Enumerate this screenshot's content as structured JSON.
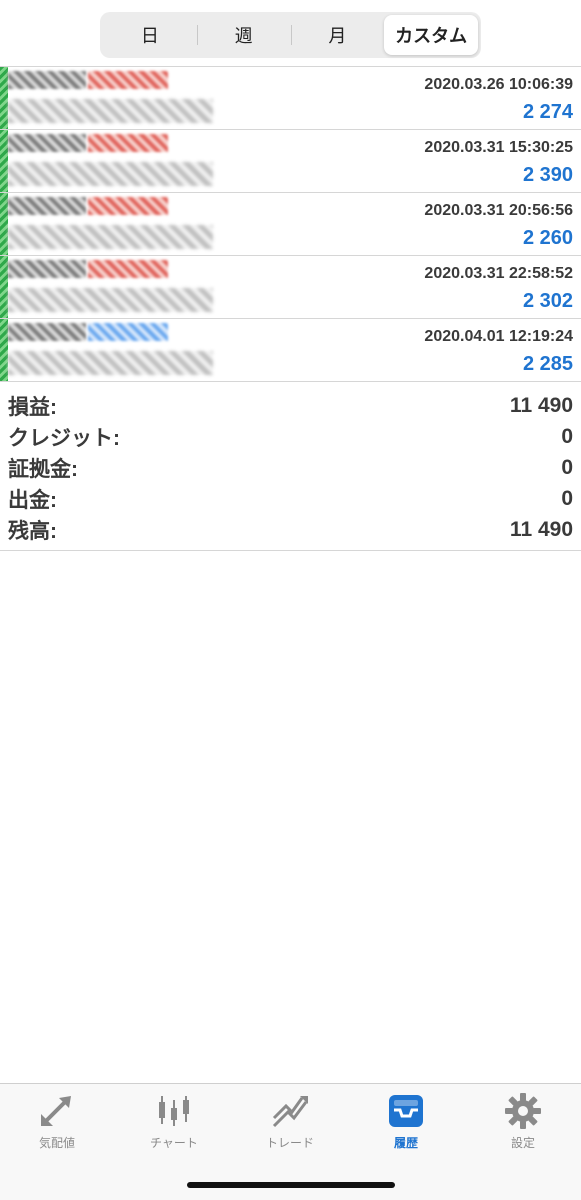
{
  "segments": [
    {
      "label": "日",
      "active": false
    },
    {
      "label": "週",
      "active": false
    },
    {
      "label": "月",
      "active": false
    },
    {
      "label": "カスタム",
      "active": true
    }
  ],
  "trades": [
    {
      "time": "2020.03.26 10:06:39",
      "profit": "2 274",
      "tag_color": "red"
    },
    {
      "time": "2020.03.31 15:30:25",
      "profit": "2 390",
      "tag_color": "red"
    },
    {
      "time": "2020.03.31 20:56:56",
      "profit": "2 260",
      "tag_color": "red"
    },
    {
      "time": "2020.03.31 22:58:52",
      "profit": "2 302",
      "tag_color": "red"
    },
    {
      "time": "2020.04.01 12:19:24",
      "profit": "2 285",
      "tag_color": "blue"
    }
  ],
  "summary": [
    {
      "label": "損益:",
      "value": "11 490"
    },
    {
      "label": "クレジット:",
      "value": "0"
    },
    {
      "label": "証拠金:",
      "value": "0"
    },
    {
      "label": "出金:",
      "value": "0"
    },
    {
      "label": "残高:",
      "value": "11 490"
    }
  ],
  "tabs": [
    {
      "label": "気配値",
      "icon": "quotes-arrows-icon",
      "active": false
    },
    {
      "label": "チャート",
      "icon": "candlestick-icon",
      "active": false
    },
    {
      "label": "トレード",
      "icon": "trade-trend-icon",
      "active": false
    },
    {
      "label": "履歴",
      "icon": "history-inbox-icon",
      "active": true
    },
    {
      "label": "設定",
      "icon": "gear-icon",
      "active": false
    }
  ],
  "colors": {
    "accent": "#1f74d0",
    "profit": "#1f74d0",
    "buy_stripe": "#2fa84a",
    "text": "#3a3a3a"
  }
}
